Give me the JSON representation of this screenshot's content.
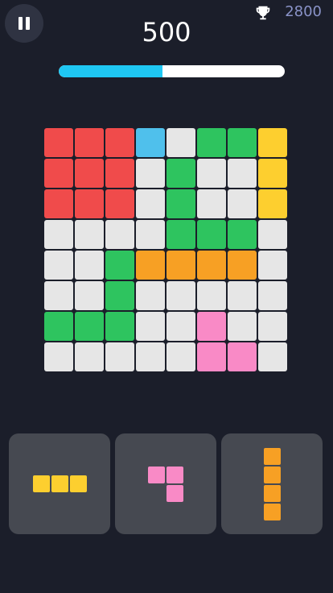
{
  "header": {
    "score": "500",
    "best_score": "2800",
    "progress_fraction": 0.46
  },
  "icons": {
    "pause": "pause-icon",
    "trophy": "trophy-icon"
  },
  "colors": {
    "red": "#f04b4b",
    "blue": "#4fc0ec",
    "green": "#2ec45f",
    "yellow": "#fdcf2f",
    "orange": "#f7a024",
    "pink": "#f98ac6",
    "empty": "#e6e6e6"
  },
  "board": {
    "size": 8,
    "rows": [
      [
        "red",
        "red",
        "red",
        "blue",
        "empty",
        "green",
        "green",
        "yellow"
      ],
      [
        "red",
        "red",
        "red",
        "empty",
        "green",
        "empty",
        "empty",
        "yellow"
      ],
      [
        "red",
        "red",
        "red",
        "empty",
        "green",
        "empty",
        "empty",
        "yellow"
      ],
      [
        "empty",
        "empty",
        "empty",
        "empty",
        "green",
        "green",
        "green",
        "empty"
      ],
      [
        "empty",
        "empty",
        "green",
        "orange",
        "orange",
        "orange",
        "orange",
        "empty"
      ],
      [
        "empty",
        "empty",
        "green",
        "empty",
        "empty",
        "empty",
        "empty",
        "empty"
      ],
      [
        "green",
        "green",
        "green",
        "empty",
        "empty",
        "pink",
        "empty",
        "empty"
      ],
      [
        "empty",
        "empty",
        "empty",
        "empty",
        "empty",
        "pink",
        "pink",
        "empty"
      ]
    ]
  },
  "tray_pieces": [
    {
      "name": "yellow-line-3",
      "color": "yellow",
      "shape": [
        [
          1,
          1,
          1
        ]
      ]
    },
    {
      "name": "pink-corner-3",
      "color": "pink",
      "shape": [
        [
          1,
          1
        ],
        [
          0,
          1
        ]
      ]
    },
    {
      "name": "orange-line-4",
      "color": "orange",
      "shape": [
        [
          1
        ],
        [
          1
        ],
        [
          1
        ],
        [
          1
        ]
      ]
    }
  ]
}
